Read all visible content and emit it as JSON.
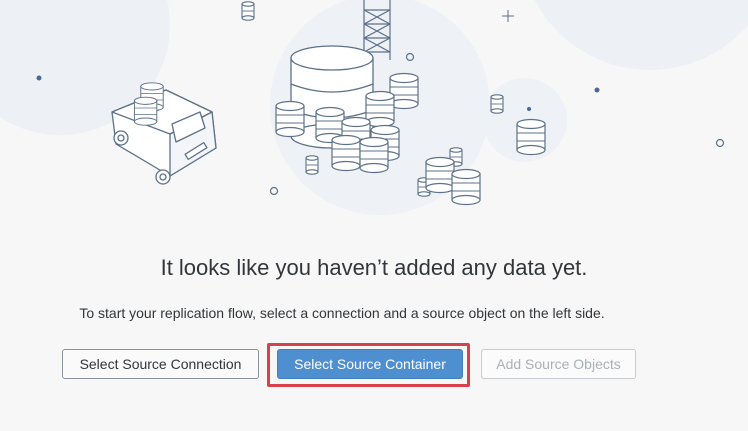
{
  "empty_state": {
    "title": "It looks like you haven’t added any data yet.",
    "subtitle": "To start your replication flow, select a connection and a source object on the left side."
  },
  "actions": {
    "select_connection": "Select Source Connection",
    "select_container": "Select Source Container",
    "add_objects": "Add Source Objects"
  },
  "colors": {
    "background": "#f7f7f7",
    "primary_button": "#4e8fd0",
    "highlight_border": "#d7414a",
    "illustration_stroke": "#5d7189",
    "illustration_accent": "#4a6a96"
  },
  "illustration": {
    "icon": "data-storage-empty-state-illustration"
  }
}
